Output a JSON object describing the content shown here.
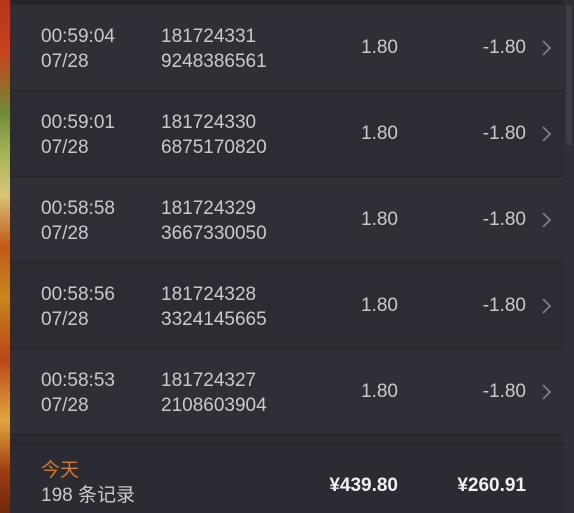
{
  "transactions": [
    {
      "time": "00:59:04",
      "date": "07/28",
      "order_line1": "181724331",
      "order_line2": "9248386561",
      "amount": "1.80",
      "change": "-1.80"
    },
    {
      "time": "00:59:01",
      "date": "07/28",
      "order_line1": "181724330",
      "order_line2": "6875170820",
      "amount": "1.80",
      "change": "-1.80"
    },
    {
      "time": "00:58:58",
      "date": "07/28",
      "order_line1": "181724329",
      "order_line2": "3667330050",
      "amount": "1.80",
      "change": "-1.80"
    },
    {
      "time": "00:58:56",
      "date": "07/28",
      "order_line1": "181724328",
      "order_line2": "3324145665",
      "amount": "1.80",
      "change": "-1.80"
    },
    {
      "time": "00:58:53",
      "date": "07/28",
      "order_line1": "181724327",
      "order_line2": "2108603904",
      "amount": "1.80",
      "change": "-1.80"
    }
  ],
  "summary": {
    "period": "今天",
    "record_count": "198 条记录",
    "total": "¥439.80",
    "net": "¥260.91"
  },
  "icons": {
    "row_chevron": "chevron-right-icon"
  },
  "colors": {
    "accent": "#d07b2e",
    "text": "#c9c9cc",
    "text_strong": "#f0f0f2",
    "background": "#2b2b33"
  }
}
